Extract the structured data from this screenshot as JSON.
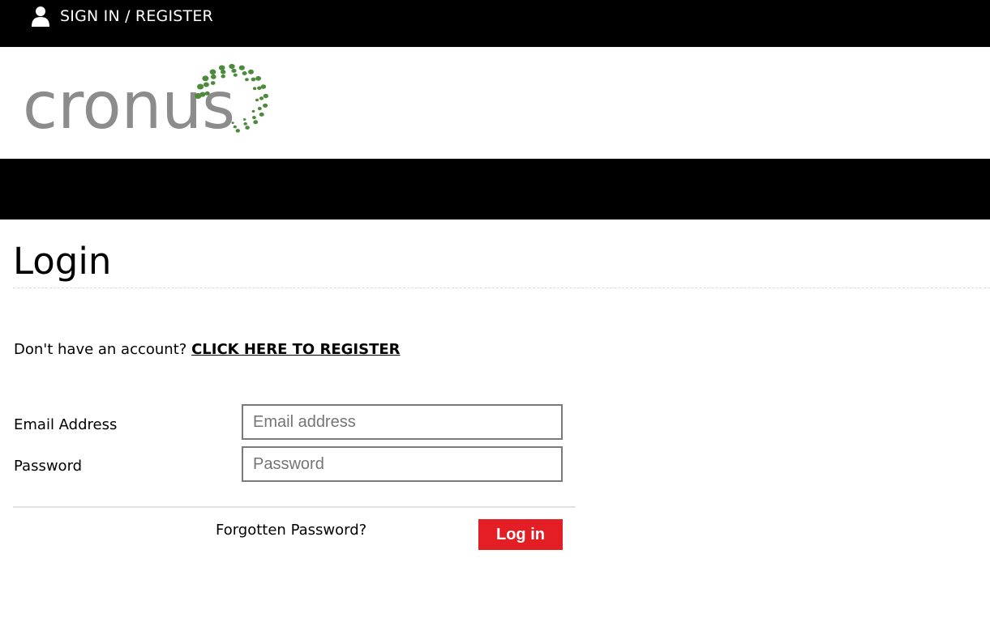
{
  "topbar": {
    "signin_label": "SIGN IN / REGISTER",
    "icon": "user-icon"
  },
  "brand": {
    "logo_text": "cronus",
    "logo_text_color": "#8c8c8c",
    "logo_dot_color": "#4e8a3e"
  },
  "page": {
    "title": "Login",
    "register_prompt": "Don't have an account?",
    "register_link": "CLICK HERE TO REGISTER"
  },
  "form": {
    "email_label": "Email Address",
    "email_placeholder": "Email address",
    "email_value": "",
    "password_label": "Password",
    "password_placeholder": "Password",
    "password_value": "",
    "forgot_label": "Forgotten Password?",
    "login_label": "Log in"
  },
  "colors": {
    "bar_background": "#000000",
    "button_accent": "#e31e24"
  }
}
